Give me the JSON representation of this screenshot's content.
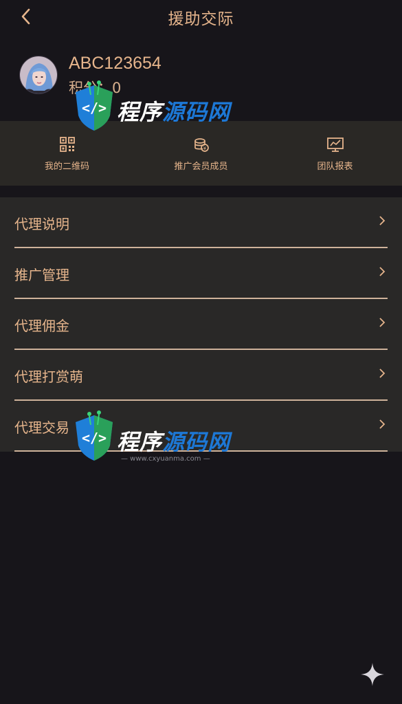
{
  "header": {
    "title": "援助交际",
    "back_icon": "chevron-left-icon"
  },
  "profile": {
    "username": "ABC123654",
    "points": "积分：0"
  },
  "actions": [
    {
      "label": "我的二维码",
      "icon": "qrcode-icon"
    },
    {
      "label": "推广会员成员",
      "icon": "coins-icon"
    },
    {
      "label": "团队报表",
      "icon": "chart-monitor-icon"
    }
  ],
  "menu": [
    {
      "label": "代理说明"
    },
    {
      "label": "推广管理"
    },
    {
      "label": "代理佣金"
    },
    {
      "label": "代理打赏萌"
    },
    {
      "label": "代理交易"
    }
  ],
  "watermark": {
    "text1": "程序",
    "text2": "源码网",
    "url": "— www.cxyuanma.com —"
  },
  "colors": {
    "accent": "#e6b58c",
    "background": "#17151a",
    "panel": "#292827",
    "divider": "#cfb39b"
  }
}
